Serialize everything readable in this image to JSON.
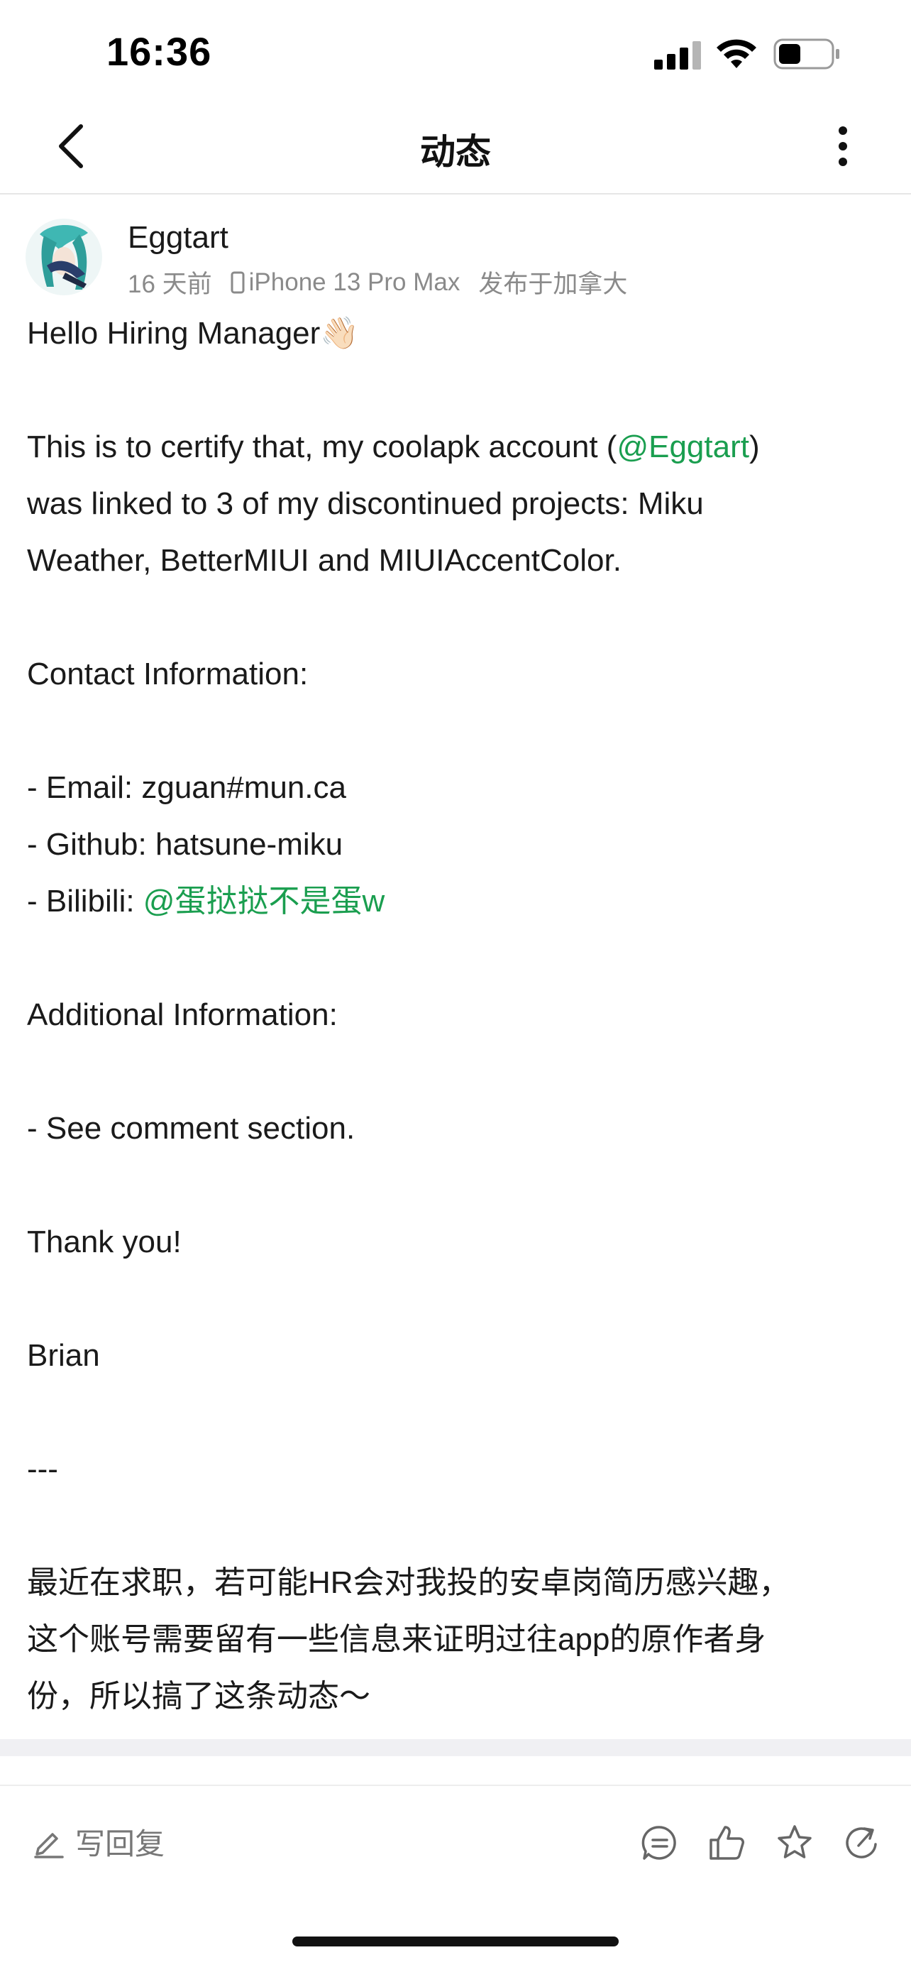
{
  "status_bar": {
    "time": "16:36"
  },
  "nav": {
    "title": "动态",
    "back_icon": "chevron-left-icon",
    "more_icon": "more-vertical-icon"
  },
  "post": {
    "author": "Eggtart",
    "time_ago": "16 天前",
    "device": "iPhone 13 Pro Max",
    "location": "发布于加拿大",
    "body": {
      "greeting": "Hello Hiring Manager👋🏻",
      "para1_before_mention": "This is to certify that, my coolapk account (",
      "para1_mention": "@Eggtart",
      "para1_after_mention": ")",
      "para1_line2": "was linked to 3 of my discontinued projects: Miku",
      "para1_line3": "Weather, BetterMIUI and MIUIAccentColor.",
      "contact_heading": "Contact Information:",
      "email": "- Email: zguan#mun.ca",
      "github": "- Github: hatsune-miku",
      "bilibili_prefix": "- Bilibili: ",
      "bilibili_mention": "@蛋挞挞不是蛋w",
      "additional_heading": "Additional Information:",
      "see_comment": "- See comment section.",
      "thanks": "Thank you!",
      "signature": "Brian",
      "divider": "---",
      "cn_line1": "最近在求职，若可能HR会对我投的安卓岗简历感兴趣，",
      "cn_line2": "这个账号需要留有一些信息来证明过往app的原作者身",
      "cn_line3": "份，所以搞了这条动态～"
    }
  },
  "bottom_bar": {
    "reply_label": "写回复",
    "icons": [
      "comment-icon",
      "like-icon",
      "favorite-icon",
      "share-icon"
    ]
  },
  "colors": {
    "mention": "#1a9e4f",
    "meta_text": "#8a8a8a",
    "separator": "#f0f0f3"
  }
}
